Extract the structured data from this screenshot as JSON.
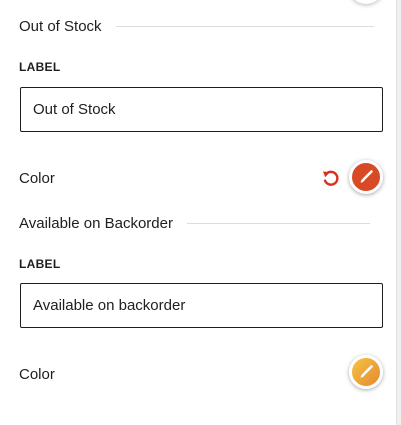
{
  "sections": [
    {
      "title": "Out of Stock",
      "field_label": "LABEL",
      "input_value": "Out of Stock",
      "color_label": "Color",
      "swatch_color": "#d84a26",
      "has_reset": true
    },
    {
      "title": "Available on Backorder",
      "field_label": "LABEL",
      "input_value": "Available on backorder",
      "color_label": "Color",
      "swatch_gradient": [
        "#f4c542",
        "#e7872f"
      ],
      "has_reset": false
    }
  ],
  "colors": {
    "reset_icon": "#d9311f",
    "text": "#1e1e1e",
    "divider": "#dcdcdc"
  },
  "icons": {
    "reset": "reset-icon",
    "brush": "paintbrush-icon"
  }
}
